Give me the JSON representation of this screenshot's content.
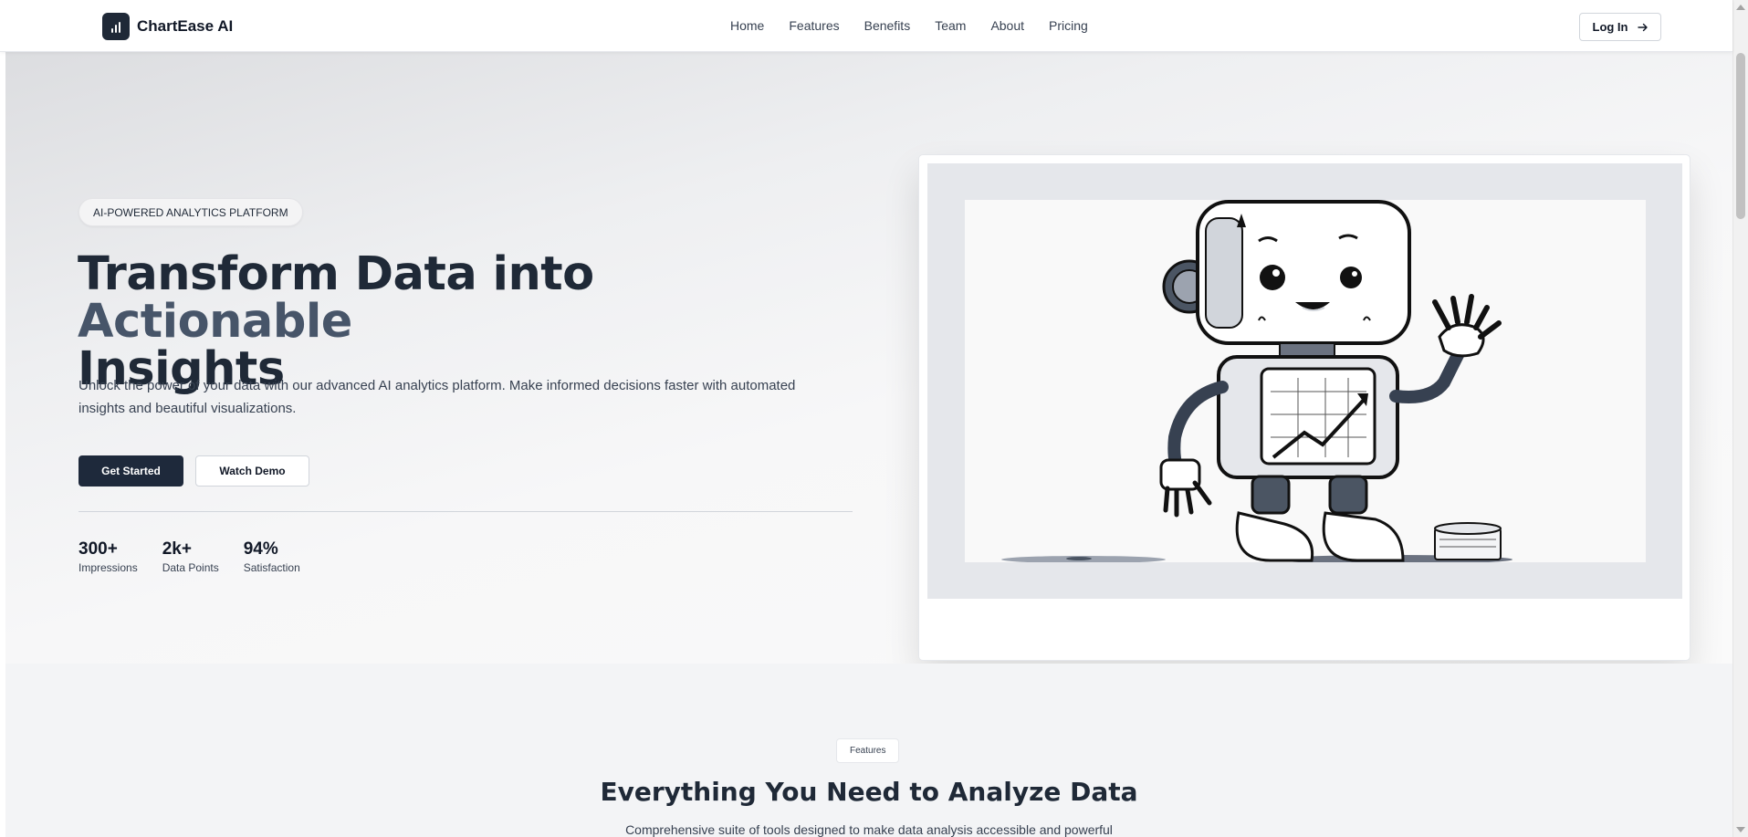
{
  "header": {
    "logo_text": "ChartEase AI",
    "nav": [
      "Home",
      "Features",
      "Benefits",
      "Team",
      "About",
      "Pricing"
    ],
    "login_label": "Log In",
    "login_icon": "arrow-right-icon"
  },
  "hero": {
    "badge": "AI-POWERED ANALYTICS PLATFORM",
    "title_part1": "Transform Data into ",
    "title_part2": "Actionable",
    "title_part3": "Insights",
    "description": "Unlock the power of your data with our advanced AI analytics platform. Make informed decisions faster with automated insights and beautiful visualizations.",
    "primary_button": "Get Started",
    "secondary_button": "Watch Demo",
    "stats": [
      {
        "value": "300+",
        "label": "Impressions"
      },
      {
        "value": "2k+",
        "label": "Data Points"
      },
      {
        "value": "94%",
        "label": "Satisfaction"
      }
    ],
    "illustration": "robot-waving-with-chart-screen"
  },
  "features": {
    "badge": "Features",
    "title": "Everything You Need to Analyze Data",
    "subtitle": "Comprehensive suite of tools designed to make data analysis accessible and powerful"
  },
  "colors": {
    "primary": "#1e293b",
    "title_dark": "#1f2937",
    "title_muted": "#475569",
    "section_bg": "#f3f4f6"
  }
}
